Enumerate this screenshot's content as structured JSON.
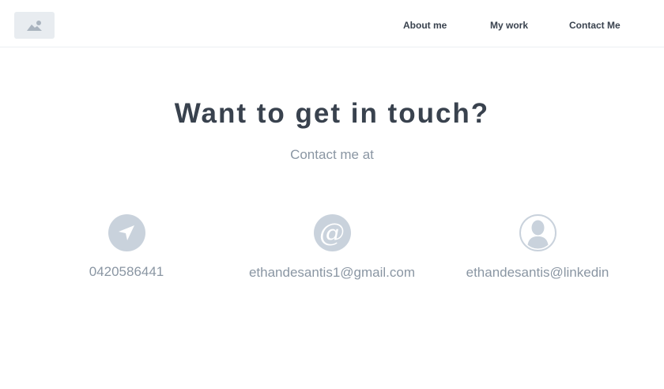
{
  "header": {
    "logo_icon": "image-placeholder-icon",
    "nav": [
      {
        "label": "About me"
      },
      {
        "label": "My work"
      },
      {
        "label": "Contact Me"
      }
    ]
  },
  "main": {
    "title": "Want to get in touch?",
    "subtitle": "Contact me at"
  },
  "contacts": [
    {
      "icon": "send-icon",
      "value": "0420586441"
    },
    {
      "icon": "at-sign-icon",
      "value": "ethandesantis1@gmail.com"
    },
    {
      "icon": "user-icon",
      "value": "ethandesantis@linkedin"
    }
  ],
  "colors": {
    "text_dark": "#39424e",
    "text_muted": "#8a96a3",
    "icon_fill": "#c9d2dc"
  }
}
